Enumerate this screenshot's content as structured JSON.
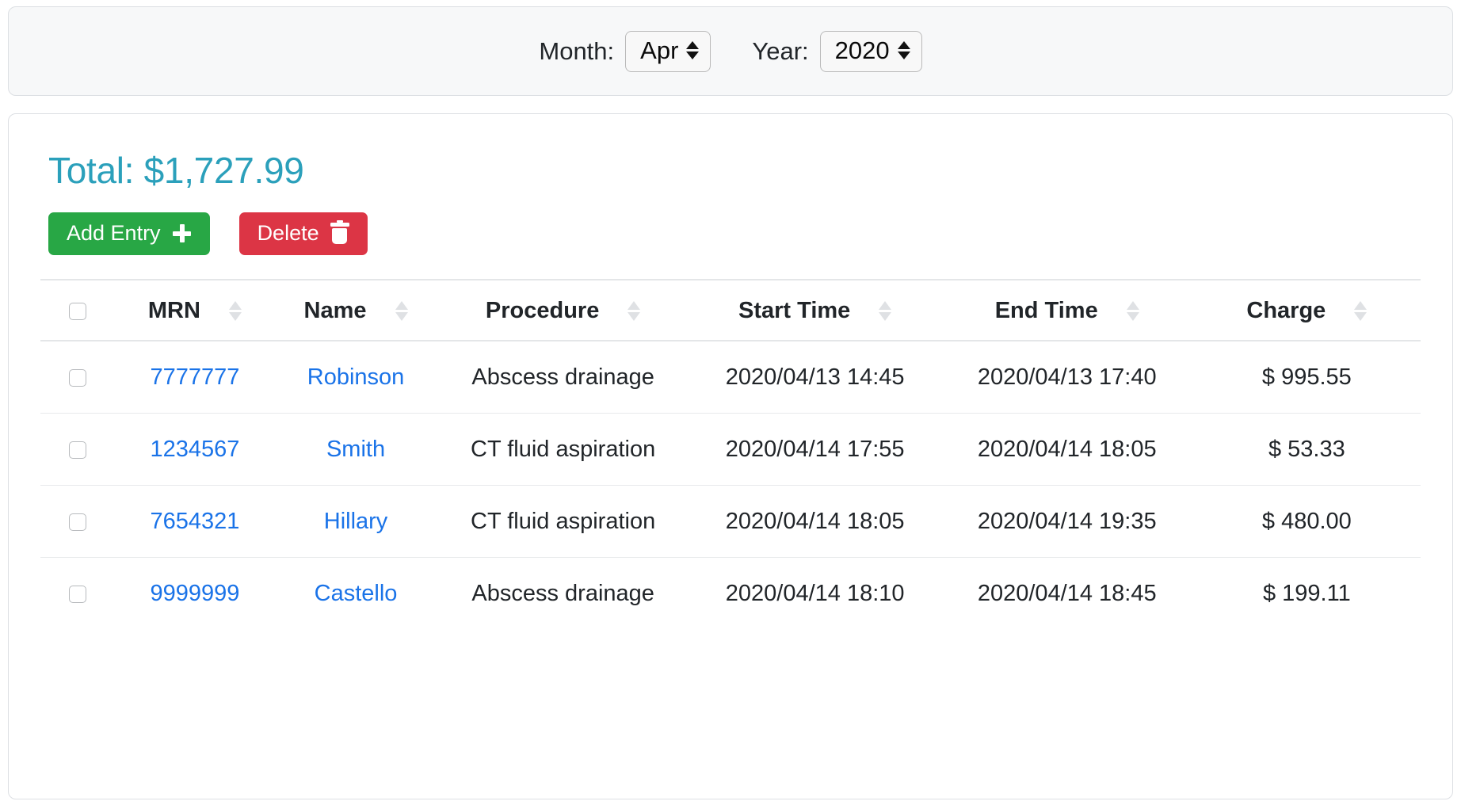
{
  "filter_bar": {
    "month_label": "Month:",
    "month_value": "Apr",
    "year_label": "Year:",
    "year_value": "2020"
  },
  "summary": {
    "total_text": "Total: $1,727.99"
  },
  "toolbar": {
    "add_label": "Add Entry",
    "delete_label": "Delete",
    "add_icon": "plus-icon",
    "delete_icon": "trash-icon",
    "add_color": "#28a745",
    "delete_color": "#dc3545"
  },
  "table": {
    "columns": [
      {
        "key": "select",
        "label": ""
      },
      {
        "key": "mrn",
        "label": "MRN"
      },
      {
        "key": "name",
        "label": "Name"
      },
      {
        "key": "procedure",
        "label": "Procedure"
      },
      {
        "key": "start",
        "label": "Start Time"
      },
      {
        "key": "end",
        "label": "End Time"
      },
      {
        "key": "charge",
        "label": "Charge"
      }
    ],
    "rows": [
      {
        "mrn": "7777777",
        "name": "Robinson",
        "procedure": "Abscess drainage",
        "start": "2020/04/13 14:45",
        "end": "2020/04/13 17:40",
        "charge": "$ 995.55"
      },
      {
        "mrn": "1234567",
        "name": "Smith",
        "procedure": "CT fluid aspiration",
        "start": "2020/04/14 17:55",
        "end": "2020/04/14 18:05",
        "charge": "$ 53.33"
      },
      {
        "mrn": "7654321",
        "name": "Hillary",
        "procedure": "CT fluid aspiration",
        "start": "2020/04/14 18:05",
        "end": "2020/04/14 19:35",
        "charge": "$ 480.00"
      },
      {
        "mrn": "9999999",
        "name": "Castello",
        "procedure": "Abscess drainage",
        "start": "2020/04/14 18:10",
        "end": "2020/04/14 18:45",
        "charge": "$ 199.11"
      }
    ]
  },
  "colors": {
    "total_teal": "#2ba0bb",
    "link_blue": "#1a73e8",
    "card_border": "#dcdfe3",
    "filter_bg": "#f7f8f9"
  }
}
